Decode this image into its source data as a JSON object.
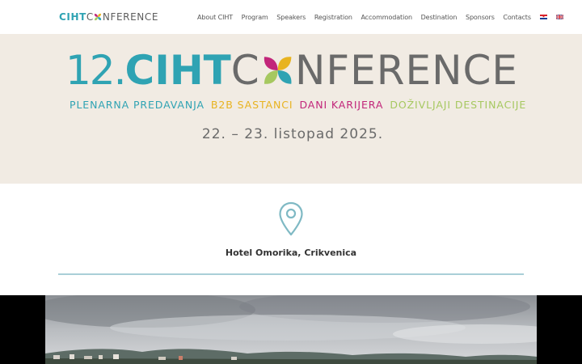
{
  "header": {
    "logo": {
      "brand": "CIHT",
      "rest": "NFERENCE"
    },
    "nav": [
      {
        "label": "About CIHT"
      },
      {
        "label": "Program"
      },
      {
        "label": "Speakers"
      },
      {
        "label": "Registration"
      },
      {
        "label": "Accommodation"
      },
      {
        "label": "Destination"
      },
      {
        "label": "Sponsors"
      },
      {
        "label": "Contacts"
      }
    ],
    "languages": [
      {
        "icon": "croatian-flag-icon"
      },
      {
        "icon": "uk-flag-icon"
      }
    ]
  },
  "hero": {
    "number": "12.",
    "brand": "CIHT",
    "rest": "NFERENCE",
    "taglines": [
      {
        "text": "PLENARNA PREDAVANJA",
        "color": "#2fa3b3"
      },
      {
        "text": "B2B SASTANCI",
        "color": "#e8b320"
      },
      {
        "text": "DANI KARIJERA",
        "color": "#c2267a"
      },
      {
        "text": "DOŽIVLJAJI DESTINACIJE",
        "color": "#a6c860"
      }
    ],
    "dates": "22. – 23. listopad 2025."
  },
  "venue": {
    "icon": "location-pin-icon",
    "name": "Hotel Omorika, Crikvenica"
  },
  "colors": {
    "accent": "#2fa3b3",
    "hero_bg": "#f1ebe3",
    "text_gray": "#6a6a6a"
  }
}
